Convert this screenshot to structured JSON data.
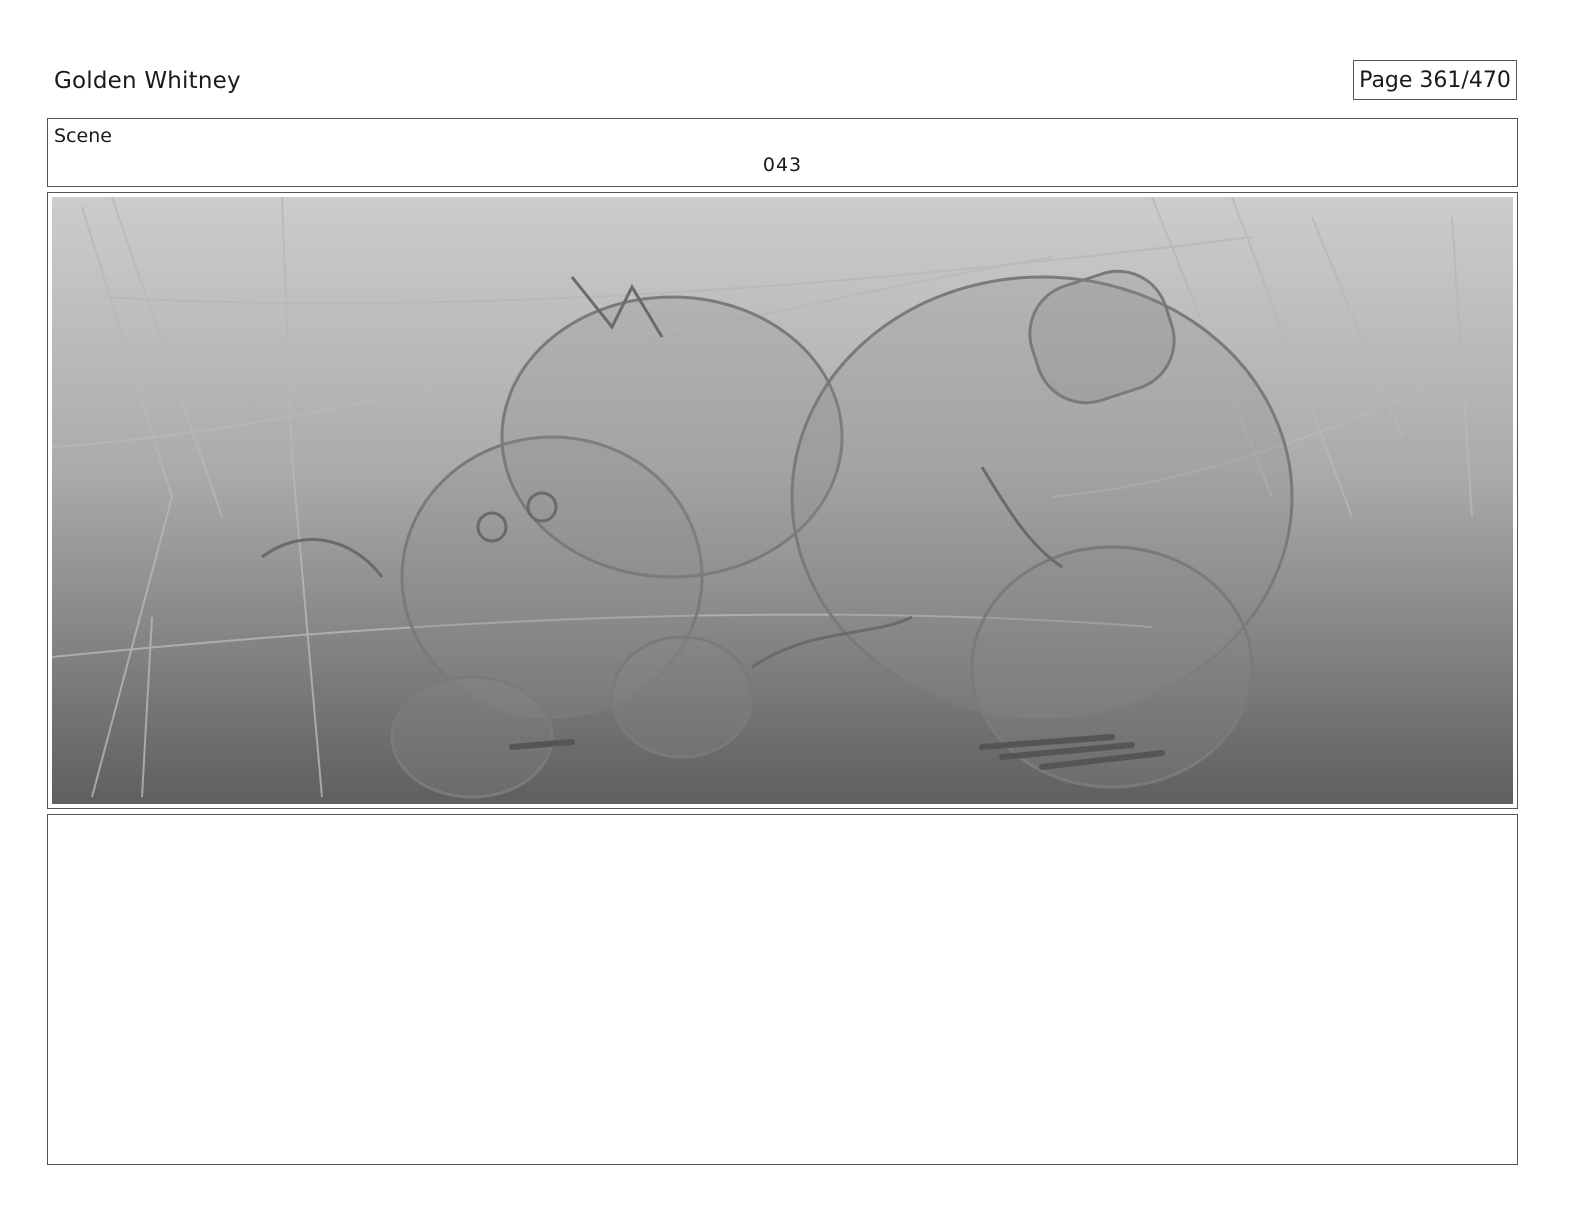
{
  "header": {
    "project_title": "Golden Whitney",
    "page_indicator": "Page 361/470"
  },
  "scene": {
    "label": "Scene",
    "number": "043"
  },
  "panel": {
    "image_description_icon": "storyboard-sketch-image"
  },
  "notes": {
    "text": ""
  }
}
